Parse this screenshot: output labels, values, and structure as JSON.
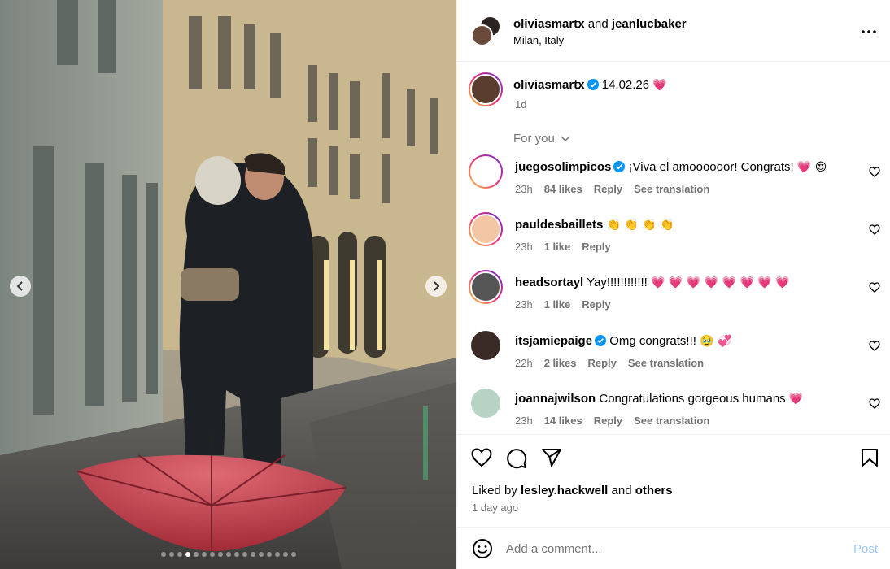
{
  "media": {
    "prev_icon": "chevron-left-icon",
    "next_icon": "chevron-right-icon",
    "dot_count": 17,
    "active_dot": 3
  },
  "header": {
    "user1": "oliviasmartx",
    "joiner": "and",
    "user2": "jeanlucbaker",
    "location": "Milan, Italy",
    "more_icon": "more-horizontal-icon"
  },
  "caption": {
    "username": "oliviasmartx",
    "text": "14.02.26",
    "emoji": "💗",
    "time": "1d"
  },
  "for_you_label": "For you",
  "comments": [
    {
      "username": "juegosolimpicos",
      "verified": true,
      "text": "¡Viva el amoooooor! Congrats!",
      "emoji": "💗 😍",
      "time": "23h",
      "likes": "84 likes",
      "reply": "Reply",
      "translate": "See translation"
    },
    {
      "username": "pauldesbaillets",
      "verified": false,
      "text": "",
      "emoji": "👏 👏 👏 👏",
      "time": "23h",
      "likes": "1 like",
      "reply": "Reply",
      "translate": ""
    },
    {
      "username": "headsortayl",
      "verified": false,
      "text": "Yay!!!!!!!!!!!!",
      "emoji": "💗 💗 💗 💗 💗 💗 💗 💗",
      "time": "23h",
      "likes": "1 like",
      "reply": "Reply",
      "translate": ""
    },
    {
      "username": "itsjamiepaige",
      "verified": true,
      "text": "Omg congrats!!!",
      "emoji": "🥹 💞",
      "time": "22h",
      "likes": "2 likes",
      "reply": "Reply",
      "translate": "See translation"
    },
    {
      "username": "joannajwilson",
      "verified": false,
      "text": "Congratulations gorgeous humans",
      "emoji": "💗",
      "time": "23h",
      "likes": "14 likes",
      "reply": "Reply",
      "translate": "See translation"
    }
  ],
  "actions": {
    "liked_prefix": "Liked by",
    "liked_user": "lesley.hackwell",
    "liked_and": "and",
    "liked_others": "others",
    "ago": "1 day ago"
  },
  "comment_box": {
    "placeholder": "Add a comment...",
    "post_label": "Post"
  },
  "colors": {
    "verified": "#0095f6",
    "heart": "#ff3040",
    "post": "#9fc8f7",
    "umbrella": "#c4424d"
  }
}
